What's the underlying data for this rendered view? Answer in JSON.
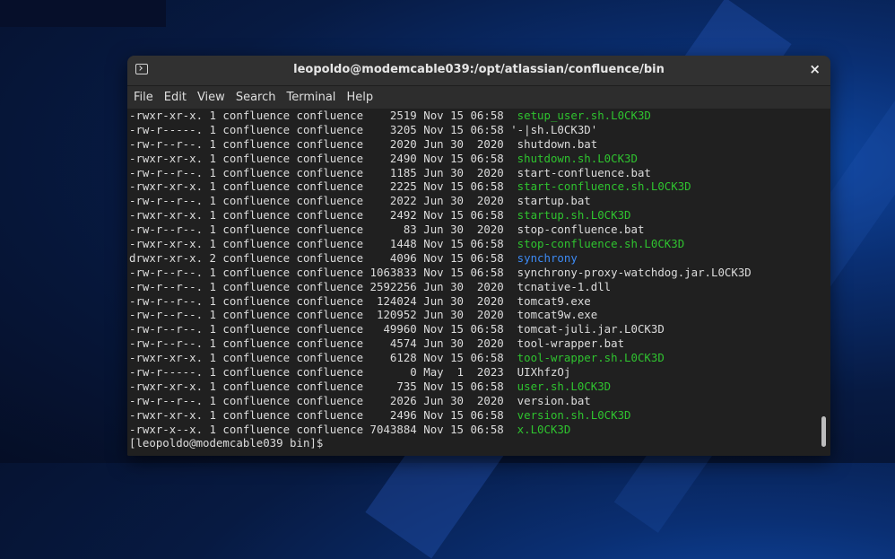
{
  "window": {
    "title": "leopoldo@modemcable039:/opt/atlassian/confluence/bin",
    "close_glyph": "×"
  },
  "menu": [
    "File",
    "Edit",
    "View",
    "Search",
    "Terminal",
    "Help"
  ],
  "terminal": {
    "rows": [
      {
        "meta": "-rwxr-xr-x. 1 confluence confluence    2519 Nov 15 06:58 ",
        "name": " setup_user.sh.L0CK3D",
        "kind": "exec"
      },
      {
        "meta": "-rw-r-----. 1 confluence confluence    3205 Nov 15 06:58 ",
        "name": "'-|sh.L0CK3D'",
        "kind": "plain"
      },
      {
        "meta": "-rw-r--r--. 1 confluence confluence    2020 Jun 30  2020 ",
        "name": " shutdown.bat",
        "kind": "plain"
      },
      {
        "meta": "-rwxr-xr-x. 1 confluence confluence    2490 Nov 15 06:58 ",
        "name": " shutdown.sh.L0CK3D",
        "kind": "exec"
      },
      {
        "meta": "-rw-r--r--. 1 confluence confluence    1185 Jun 30  2020 ",
        "name": " start-confluence.bat",
        "kind": "plain"
      },
      {
        "meta": "-rwxr-xr-x. 1 confluence confluence    2225 Nov 15 06:58 ",
        "name": " start-confluence.sh.L0CK3D",
        "kind": "exec"
      },
      {
        "meta": "-rw-r--r--. 1 confluence confluence    2022 Jun 30  2020 ",
        "name": " startup.bat",
        "kind": "plain"
      },
      {
        "meta": "-rwxr-xr-x. 1 confluence confluence    2492 Nov 15 06:58 ",
        "name": " startup.sh.L0CK3D",
        "kind": "exec"
      },
      {
        "meta": "-rw-r--r--. 1 confluence confluence      83 Jun 30  2020 ",
        "name": " stop-confluence.bat",
        "kind": "plain"
      },
      {
        "meta": "-rwxr-xr-x. 1 confluence confluence    1448 Nov 15 06:58 ",
        "name": " stop-confluence.sh.L0CK3D",
        "kind": "exec"
      },
      {
        "meta": "drwxr-xr-x. 2 confluence confluence    4096 Nov 15 06:58 ",
        "name": " synchrony",
        "kind": "dir"
      },
      {
        "meta": "-rw-r--r--. 1 confluence confluence 1063833 Nov 15 06:58 ",
        "name": " synchrony-proxy-watchdog.jar.L0CK3D",
        "kind": "plain"
      },
      {
        "meta": "-rw-r--r--. 1 confluence confluence 2592256 Jun 30  2020 ",
        "name": " tcnative-1.dll",
        "kind": "plain"
      },
      {
        "meta": "-rw-r--r--. 1 confluence confluence  124024 Jun 30  2020 ",
        "name": " tomcat9.exe",
        "kind": "plain"
      },
      {
        "meta": "-rw-r--r--. 1 confluence confluence  120952 Jun 30  2020 ",
        "name": " tomcat9w.exe",
        "kind": "plain"
      },
      {
        "meta": "-rw-r--r--. 1 confluence confluence   49960 Nov 15 06:58 ",
        "name": " tomcat-juli.jar.L0CK3D",
        "kind": "plain"
      },
      {
        "meta": "-rw-r--r--. 1 confluence confluence    4574 Jun 30  2020 ",
        "name": " tool-wrapper.bat",
        "kind": "plain"
      },
      {
        "meta": "-rwxr-xr-x. 1 confluence confluence    6128 Nov 15 06:58 ",
        "name": " tool-wrapper.sh.L0CK3D",
        "kind": "exec"
      },
      {
        "meta": "-rw-r-----. 1 confluence confluence       0 May  1  2023 ",
        "name": " UIXhfzOj",
        "kind": "plain"
      },
      {
        "meta": "-rwxr-xr-x. 1 confluence confluence     735 Nov 15 06:58 ",
        "name": " user.sh.L0CK3D",
        "kind": "exec"
      },
      {
        "meta": "-rw-r--r--. 1 confluence confluence    2026 Jun 30  2020 ",
        "name": " version.bat",
        "kind": "plain"
      },
      {
        "meta": "-rwxr-xr-x. 1 confluence confluence    2496 Nov 15 06:58 ",
        "name": " version.sh.L0CK3D",
        "kind": "exec"
      },
      {
        "meta": "-rwxr-x--x. 1 confluence confluence 7043884 Nov 15 06:58 ",
        "name": " x.L0CK3D",
        "kind": "exec"
      }
    ],
    "prompt": "[leopoldo@modemcable039 bin]$ "
  },
  "colors": {
    "executable": "#2fc32f",
    "directory": "#3d8bf5",
    "text": "#dcdcdc",
    "background": "#202020"
  }
}
